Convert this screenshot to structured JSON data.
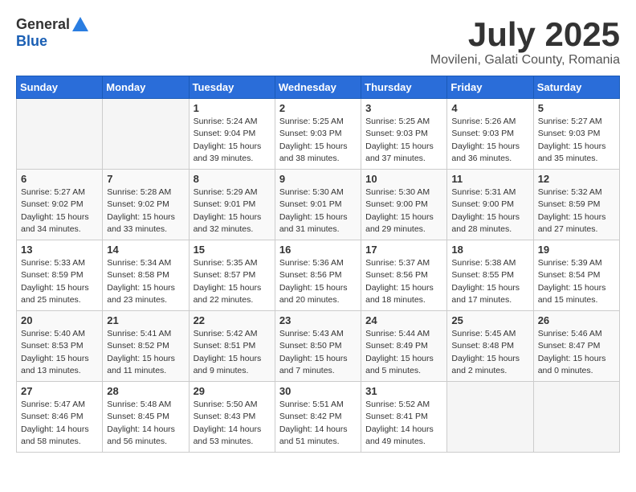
{
  "header": {
    "logo_general": "General",
    "logo_blue": "Blue",
    "title": "July 2025",
    "subtitle": "Movileni, Galati County, Romania"
  },
  "weekdays": [
    "Sunday",
    "Monday",
    "Tuesday",
    "Wednesday",
    "Thursday",
    "Friday",
    "Saturday"
  ],
  "weeks": [
    [
      {
        "day": "",
        "empty": true
      },
      {
        "day": "",
        "empty": true
      },
      {
        "day": "1",
        "sunrise": "Sunrise: 5:24 AM",
        "sunset": "Sunset: 9:04 PM",
        "daylight": "Daylight: 15 hours and 39 minutes."
      },
      {
        "day": "2",
        "sunrise": "Sunrise: 5:25 AM",
        "sunset": "Sunset: 9:03 PM",
        "daylight": "Daylight: 15 hours and 38 minutes."
      },
      {
        "day": "3",
        "sunrise": "Sunrise: 5:25 AM",
        "sunset": "Sunset: 9:03 PM",
        "daylight": "Daylight: 15 hours and 37 minutes."
      },
      {
        "day": "4",
        "sunrise": "Sunrise: 5:26 AM",
        "sunset": "Sunset: 9:03 PM",
        "daylight": "Daylight: 15 hours and 36 minutes."
      },
      {
        "day": "5",
        "sunrise": "Sunrise: 5:27 AM",
        "sunset": "Sunset: 9:03 PM",
        "daylight": "Daylight: 15 hours and 35 minutes."
      }
    ],
    [
      {
        "day": "6",
        "sunrise": "Sunrise: 5:27 AM",
        "sunset": "Sunset: 9:02 PM",
        "daylight": "Daylight: 15 hours and 34 minutes."
      },
      {
        "day": "7",
        "sunrise": "Sunrise: 5:28 AM",
        "sunset": "Sunset: 9:02 PM",
        "daylight": "Daylight: 15 hours and 33 minutes."
      },
      {
        "day": "8",
        "sunrise": "Sunrise: 5:29 AM",
        "sunset": "Sunset: 9:01 PM",
        "daylight": "Daylight: 15 hours and 32 minutes."
      },
      {
        "day": "9",
        "sunrise": "Sunrise: 5:30 AM",
        "sunset": "Sunset: 9:01 PM",
        "daylight": "Daylight: 15 hours and 31 minutes."
      },
      {
        "day": "10",
        "sunrise": "Sunrise: 5:30 AM",
        "sunset": "Sunset: 9:00 PM",
        "daylight": "Daylight: 15 hours and 29 minutes."
      },
      {
        "day": "11",
        "sunrise": "Sunrise: 5:31 AM",
        "sunset": "Sunset: 9:00 PM",
        "daylight": "Daylight: 15 hours and 28 minutes."
      },
      {
        "day": "12",
        "sunrise": "Sunrise: 5:32 AM",
        "sunset": "Sunset: 8:59 PM",
        "daylight": "Daylight: 15 hours and 27 minutes."
      }
    ],
    [
      {
        "day": "13",
        "sunrise": "Sunrise: 5:33 AM",
        "sunset": "Sunset: 8:59 PM",
        "daylight": "Daylight: 15 hours and 25 minutes."
      },
      {
        "day": "14",
        "sunrise": "Sunrise: 5:34 AM",
        "sunset": "Sunset: 8:58 PM",
        "daylight": "Daylight: 15 hours and 23 minutes."
      },
      {
        "day": "15",
        "sunrise": "Sunrise: 5:35 AM",
        "sunset": "Sunset: 8:57 PM",
        "daylight": "Daylight: 15 hours and 22 minutes."
      },
      {
        "day": "16",
        "sunrise": "Sunrise: 5:36 AM",
        "sunset": "Sunset: 8:56 PM",
        "daylight": "Daylight: 15 hours and 20 minutes."
      },
      {
        "day": "17",
        "sunrise": "Sunrise: 5:37 AM",
        "sunset": "Sunset: 8:56 PM",
        "daylight": "Daylight: 15 hours and 18 minutes."
      },
      {
        "day": "18",
        "sunrise": "Sunrise: 5:38 AM",
        "sunset": "Sunset: 8:55 PM",
        "daylight": "Daylight: 15 hours and 17 minutes."
      },
      {
        "day": "19",
        "sunrise": "Sunrise: 5:39 AM",
        "sunset": "Sunset: 8:54 PM",
        "daylight": "Daylight: 15 hours and 15 minutes."
      }
    ],
    [
      {
        "day": "20",
        "sunrise": "Sunrise: 5:40 AM",
        "sunset": "Sunset: 8:53 PM",
        "daylight": "Daylight: 15 hours and 13 minutes."
      },
      {
        "day": "21",
        "sunrise": "Sunrise: 5:41 AM",
        "sunset": "Sunset: 8:52 PM",
        "daylight": "Daylight: 15 hours and 11 minutes."
      },
      {
        "day": "22",
        "sunrise": "Sunrise: 5:42 AM",
        "sunset": "Sunset: 8:51 PM",
        "daylight": "Daylight: 15 hours and 9 minutes."
      },
      {
        "day": "23",
        "sunrise": "Sunrise: 5:43 AM",
        "sunset": "Sunset: 8:50 PM",
        "daylight": "Daylight: 15 hours and 7 minutes."
      },
      {
        "day": "24",
        "sunrise": "Sunrise: 5:44 AM",
        "sunset": "Sunset: 8:49 PM",
        "daylight": "Daylight: 15 hours and 5 minutes."
      },
      {
        "day": "25",
        "sunrise": "Sunrise: 5:45 AM",
        "sunset": "Sunset: 8:48 PM",
        "daylight": "Daylight: 15 hours and 2 minutes."
      },
      {
        "day": "26",
        "sunrise": "Sunrise: 5:46 AM",
        "sunset": "Sunset: 8:47 PM",
        "daylight": "Daylight: 15 hours and 0 minutes."
      }
    ],
    [
      {
        "day": "27",
        "sunrise": "Sunrise: 5:47 AM",
        "sunset": "Sunset: 8:46 PM",
        "daylight": "Daylight: 14 hours and 58 minutes."
      },
      {
        "day": "28",
        "sunrise": "Sunrise: 5:48 AM",
        "sunset": "Sunset: 8:45 PM",
        "daylight": "Daylight: 14 hours and 56 minutes."
      },
      {
        "day": "29",
        "sunrise": "Sunrise: 5:50 AM",
        "sunset": "Sunset: 8:43 PM",
        "daylight": "Daylight: 14 hours and 53 minutes."
      },
      {
        "day": "30",
        "sunrise": "Sunrise: 5:51 AM",
        "sunset": "Sunset: 8:42 PM",
        "daylight": "Daylight: 14 hours and 51 minutes."
      },
      {
        "day": "31",
        "sunrise": "Sunrise: 5:52 AM",
        "sunset": "Sunset: 8:41 PM",
        "daylight": "Daylight: 14 hours and 49 minutes."
      },
      {
        "day": "",
        "empty": true
      },
      {
        "day": "",
        "empty": true
      }
    ]
  ]
}
